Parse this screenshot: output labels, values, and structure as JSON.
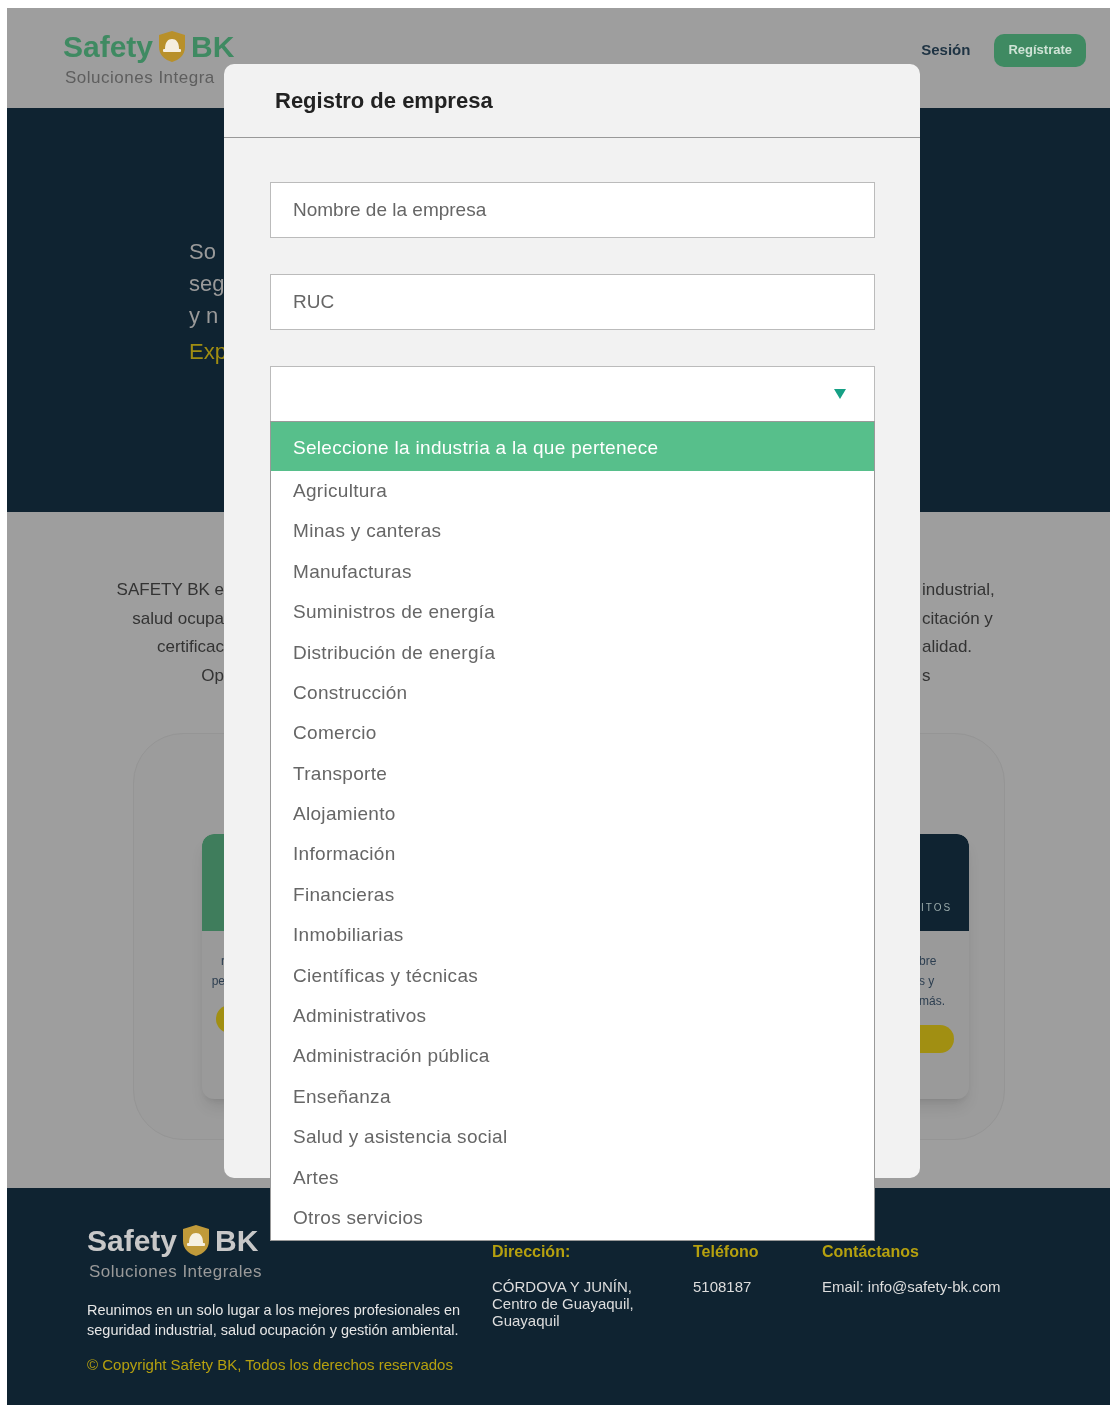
{
  "header": {
    "logo": {
      "word_1": "Safety",
      "word_2": "BK",
      "tagline": "Soluciones Integra"
    },
    "nav_link": "Sesión",
    "button": "Regístrate"
  },
  "hero": {
    "lines": [
      "So",
      "seg",
      "y n"
    ],
    "link": "Exp"
  },
  "about": {
    "left_lines": [
      "SAFETY BK e",
      "salud ocupa",
      "certificac",
      "Op"
    ],
    "right_lines": [
      "industrial,",
      "citación y",
      "alidad.",
      "s"
    ]
  },
  "cards": [
    {
      "kind": "green",
      "lines": [
        "r",
        "pe"
      ]
    },
    {
      "kind": "dark",
      "label": "ITOS",
      "lines": [
        "bre",
        "s y",
        "más."
      ]
    }
  ],
  "modal": {
    "title": "Registro de empresa",
    "fields": [
      {
        "placeholder": "Nombre de la empresa"
      },
      {
        "placeholder": "RUC"
      }
    ],
    "select": {
      "expanded": true,
      "options": [
        {
          "label": "Seleccione la industria a la que pertenece",
          "selected": true
        },
        {
          "label": "Agricultura",
          "selected": false
        },
        {
          "label": "Minas y canteras",
          "selected": false
        },
        {
          "label": "Manufacturas",
          "selected": false
        },
        {
          "label": "Suministros de energía",
          "selected": false
        },
        {
          "label": "Distribución de energía",
          "selected": false
        },
        {
          "label": "Construcción",
          "selected": false
        },
        {
          "label": "Comercio",
          "selected": false
        },
        {
          "label": "Transporte",
          "selected": false
        },
        {
          "label": "Alojamiento",
          "selected": false
        },
        {
          "label": "Información",
          "selected": false
        },
        {
          "label": "Financieras",
          "selected": false
        },
        {
          "label": "Inmobiliarias",
          "selected": false
        },
        {
          "label": "Científicas y técnicas",
          "selected": false
        },
        {
          "label": "Administrativos",
          "selected": false
        },
        {
          "label": "Administración pública",
          "selected": false
        },
        {
          "label": "Enseñanza",
          "selected": false
        },
        {
          "label": "Salud y asistencia social",
          "selected": false
        },
        {
          "label": "Artes",
          "selected": false
        },
        {
          "label": "Otros servicios",
          "selected": false
        }
      ]
    }
  },
  "footer": {
    "logo": {
      "word_1": "Safety",
      "word_2": "BK",
      "tagline": "Soluciones Integrales"
    },
    "description": "Reunimos en un solo lugar a los mejores profesionales en seguridad industrial, salud ocupación y gestión ambiental.",
    "copyright": "© Copyright Safety BK,  Todos los derechos reservados",
    "columns": [
      {
        "heading": "Dirección:",
        "lines": [
          "CÓRDOVA Y JUNÍN,",
          "Centro de Guayaquil,",
          "Guayaquil"
        ]
      },
      {
        "heading": "Teléfono",
        "lines": [
          "5108187"
        ]
      },
      {
        "heading": "Contáctanos",
        "lines": [
          "Email: info@safety-bk.com"
        ]
      }
    ]
  }
}
